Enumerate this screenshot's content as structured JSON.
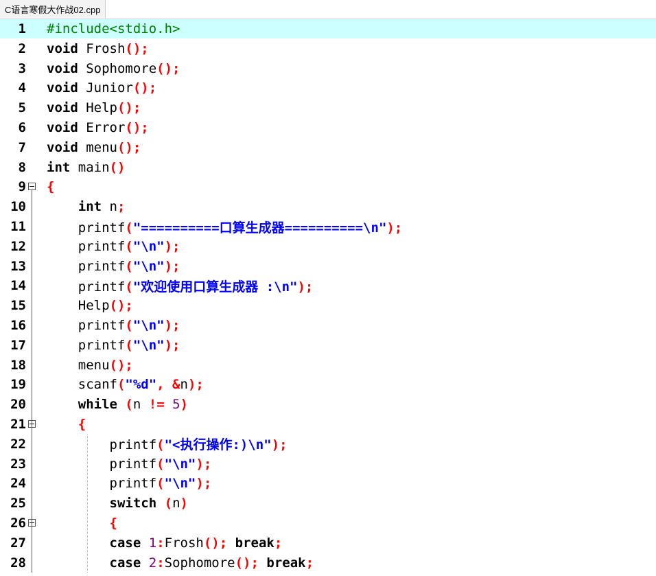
{
  "tab": {
    "title": "C语言寒假大作战02.cpp"
  },
  "editor": {
    "active_line": 1,
    "lines": [
      {
        "no": "1",
        "tokens": [
          {
            "t": "#include<stdio.h>",
            "c": "pp"
          }
        ]
      },
      {
        "no": "2",
        "tokens": [
          {
            "t": "void",
            "c": "kw"
          },
          {
            "t": " Frosh",
            "c": "id"
          },
          {
            "t": "();",
            "c": "sym"
          }
        ]
      },
      {
        "no": "3",
        "tokens": [
          {
            "t": "void",
            "c": "kw"
          },
          {
            "t": " Sophomore",
            "c": "id"
          },
          {
            "t": "();",
            "c": "sym"
          }
        ]
      },
      {
        "no": "4",
        "tokens": [
          {
            "t": "void",
            "c": "kw"
          },
          {
            "t": " Junior",
            "c": "id"
          },
          {
            "t": "();",
            "c": "sym"
          }
        ]
      },
      {
        "no": "5",
        "tokens": [
          {
            "t": "void",
            "c": "kw"
          },
          {
            "t": " Help",
            "c": "id"
          },
          {
            "t": "();",
            "c": "sym"
          }
        ]
      },
      {
        "no": "6",
        "tokens": [
          {
            "t": "void",
            "c": "kw"
          },
          {
            "t": " Error",
            "c": "id"
          },
          {
            "t": "();",
            "c": "sym"
          }
        ]
      },
      {
        "no": "7",
        "tokens": [
          {
            "t": "void",
            "c": "kw"
          },
          {
            "t": " menu",
            "c": "id"
          },
          {
            "t": "();",
            "c": "sym"
          }
        ]
      },
      {
        "no": "8",
        "tokens": [
          {
            "t": "int",
            "c": "kw"
          },
          {
            "t": " main",
            "c": "id"
          },
          {
            "t": "()",
            "c": "sym"
          }
        ]
      },
      {
        "no": "9",
        "fold": true,
        "tokens": [
          {
            "t": "{",
            "c": "sym"
          }
        ]
      },
      {
        "no": "10",
        "tokens": [
          {
            "t": "    ",
            "c": "id"
          },
          {
            "t": "int",
            "c": "kw"
          },
          {
            "t": " n",
            "c": "id"
          },
          {
            "t": ";",
            "c": "sym"
          }
        ]
      },
      {
        "no": "11",
        "tokens": [
          {
            "t": "    printf",
            "c": "id"
          },
          {
            "t": "(",
            "c": "sym"
          },
          {
            "t": "\"==========口算生成器==========\\n\"",
            "c": "str"
          },
          {
            "t": ");",
            "c": "sym"
          }
        ]
      },
      {
        "no": "12",
        "tokens": [
          {
            "t": "    printf",
            "c": "id"
          },
          {
            "t": "(",
            "c": "sym"
          },
          {
            "t": "\"\\n\"",
            "c": "str"
          },
          {
            "t": ");",
            "c": "sym"
          }
        ]
      },
      {
        "no": "13",
        "tokens": [
          {
            "t": "    printf",
            "c": "id"
          },
          {
            "t": "(",
            "c": "sym"
          },
          {
            "t": "\"\\n\"",
            "c": "str"
          },
          {
            "t": ");",
            "c": "sym"
          }
        ]
      },
      {
        "no": "14",
        "tokens": [
          {
            "t": "    printf",
            "c": "id"
          },
          {
            "t": "(",
            "c": "sym"
          },
          {
            "t": "\"欢迎使用口算生成器 :\\n\"",
            "c": "str"
          },
          {
            "t": ");",
            "c": "sym"
          }
        ]
      },
      {
        "no": "15",
        "tokens": [
          {
            "t": "    Help",
            "c": "id"
          },
          {
            "t": "();",
            "c": "sym"
          }
        ]
      },
      {
        "no": "16",
        "tokens": [
          {
            "t": "    printf",
            "c": "id"
          },
          {
            "t": "(",
            "c": "sym"
          },
          {
            "t": "\"\\n\"",
            "c": "str"
          },
          {
            "t": ");",
            "c": "sym"
          }
        ]
      },
      {
        "no": "17",
        "tokens": [
          {
            "t": "    printf",
            "c": "id"
          },
          {
            "t": "(",
            "c": "sym"
          },
          {
            "t": "\"\\n\"",
            "c": "str"
          },
          {
            "t": ");",
            "c": "sym"
          }
        ]
      },
      {
        "no": "18",
        "tokens": [
          {
            "t": "    menu",
            "c": "id"
          },
          {
            "t": "();",
            "c": "sym"
          }
        ]
      },
      {
        "no": "19",
        "tokens": [
          {
            "t": "    scanf",
            "c": "id"
          },
          {
            "t": "(",
            "c": "sym"
          },
          {
            "t": "\"%d\"",
            "c": "str"
          },
          {
            "t": ", &",
            "c": "sym"
          },
          {
            "t": "n",
            "c": "id"
          },
          {
            "t": ");",
            "c": "sym"
          }
        ]
      },
      {
        "no": "20",
        "tokens": [
          {
            "t": "    ",
            "c": "id"
          },
          {
            "t": "while",
            "c": "kw"
          },
          {
            "t": " ",
            "c": "id"
          },
          {
            "t": "(",
            "c": "sym"
          },
          {
            "t": "n ",
            "c": "id"
          },
          {
            "t": "!=",
            "c": "sym"
          },
          {
            "t": " ",
            "c": "id"
          },
          {
            "t": "5",
            "c": "num"
          },
          {
            "t": ")",
            "c": "sym"
          }
        ]
      },
      {
        "no": "21",
        "fold": true,
        "tokens": [
          {
            "t": "    ",
            "c": "id"
          },
          {
            "t": "{",
            "c": "sym"
          }
        ]
      },
      {
        "no": "22",
        "tokens": [
          {
            "t": "        printf",
            "c": "id"
          },
          {
            "t": "(",
            "c": "sym"
          },
          {
            "t": "\"<执行操作:)\\n\"",
            "c": "str"
          },
          {
            "t": ");",
            "c": "sym"
          }
        ]
      },
      {
        "no": "23",
        "tokens": [
          {
            "t": "        printf",
            "c": "id"
          },
          {
            "t": "(",
            "c": "sym"
          },
          {
            "t": "\"\\n\"",
            "c": "str"
          },
          {
            "t": ");",
            "c": "sym"
          }
        ]
      },
      {
        "no": "24",
        "tokens": [
          {
            "t": "        printf",
            "c": "id"
          },
          {
            "t": "(",
            "c": "sym"
          },
          {
            "t": "\"\\n\"",
            "c": "str"
          },
          {
            "t": ");",
            "c": "sym"
          }
        ]
      },
      {
        "no": "25",
        "tokens": [
          {
            "t": "        ",
            "c": "id"
          },
          {
            "t": "switch",
            "c": "kw"
          },
          {
            "t": " ",
            "c": "id"
          },
          {
            "t": "(",
            "c": "sym"
          },
          {
            "t": "n",
            "c": "id"
          },
          {
            "t": ")",
            "c": "sym"
          }
        ]
      },
      {
        "no": "26",
        "fold": true,
        "tokens": [
          {
            "t": "        ",
            "c": "id"
          },
          {
            "t": "{",
            "c": "sym"
          }
        ]
      },
      {
        "no": "27",
        "tokens": [
          {
            "t": "        ",
            "c": "id"
          },
          {
            "t": "case",
            "c": "kw"
          },
          {
            "t": " ",
            "c": "id"
          },
          {
            "t": "1",
            "c": "num"
          },
          {
            "t": ":",
            "c": "sym"
          },
          {
            "t": "Frosh",
            "c": "id"
          },
          {
            "t": "();",
            "c": "sym"
          },
          {
            "t": " ",
            "c": "id"
          },
          {
            "t": "break",
            "c": "kw"
          },
          {
            "t": ";",
            "c": "sym"
          }
        ]
      },
      {
        "no": "28",
        "tokens": [
          {
            "t": "        ",
            "c": "id"
          },
          {
            "t": "case",
            "c": "kw"
          },
          {
            "t": " ",
            "c": "id"
          },
          {
            "t": "2",
            "c": "num"
          },
          {
            "t": ":",
            "c": "sym"
          },
          {
            "t": "Sophomore",
            "c": "id"
          },
          {
            "t": "();",
            "c": "sym"
          },
          {
            "t": " ",
            "c": "id"
          },
          {
            "t": "break",
            "c": "kw"
          },
          {
            "t": ";",
            "c": "sym"
          }
        ]
      }
    ]
  }
}
